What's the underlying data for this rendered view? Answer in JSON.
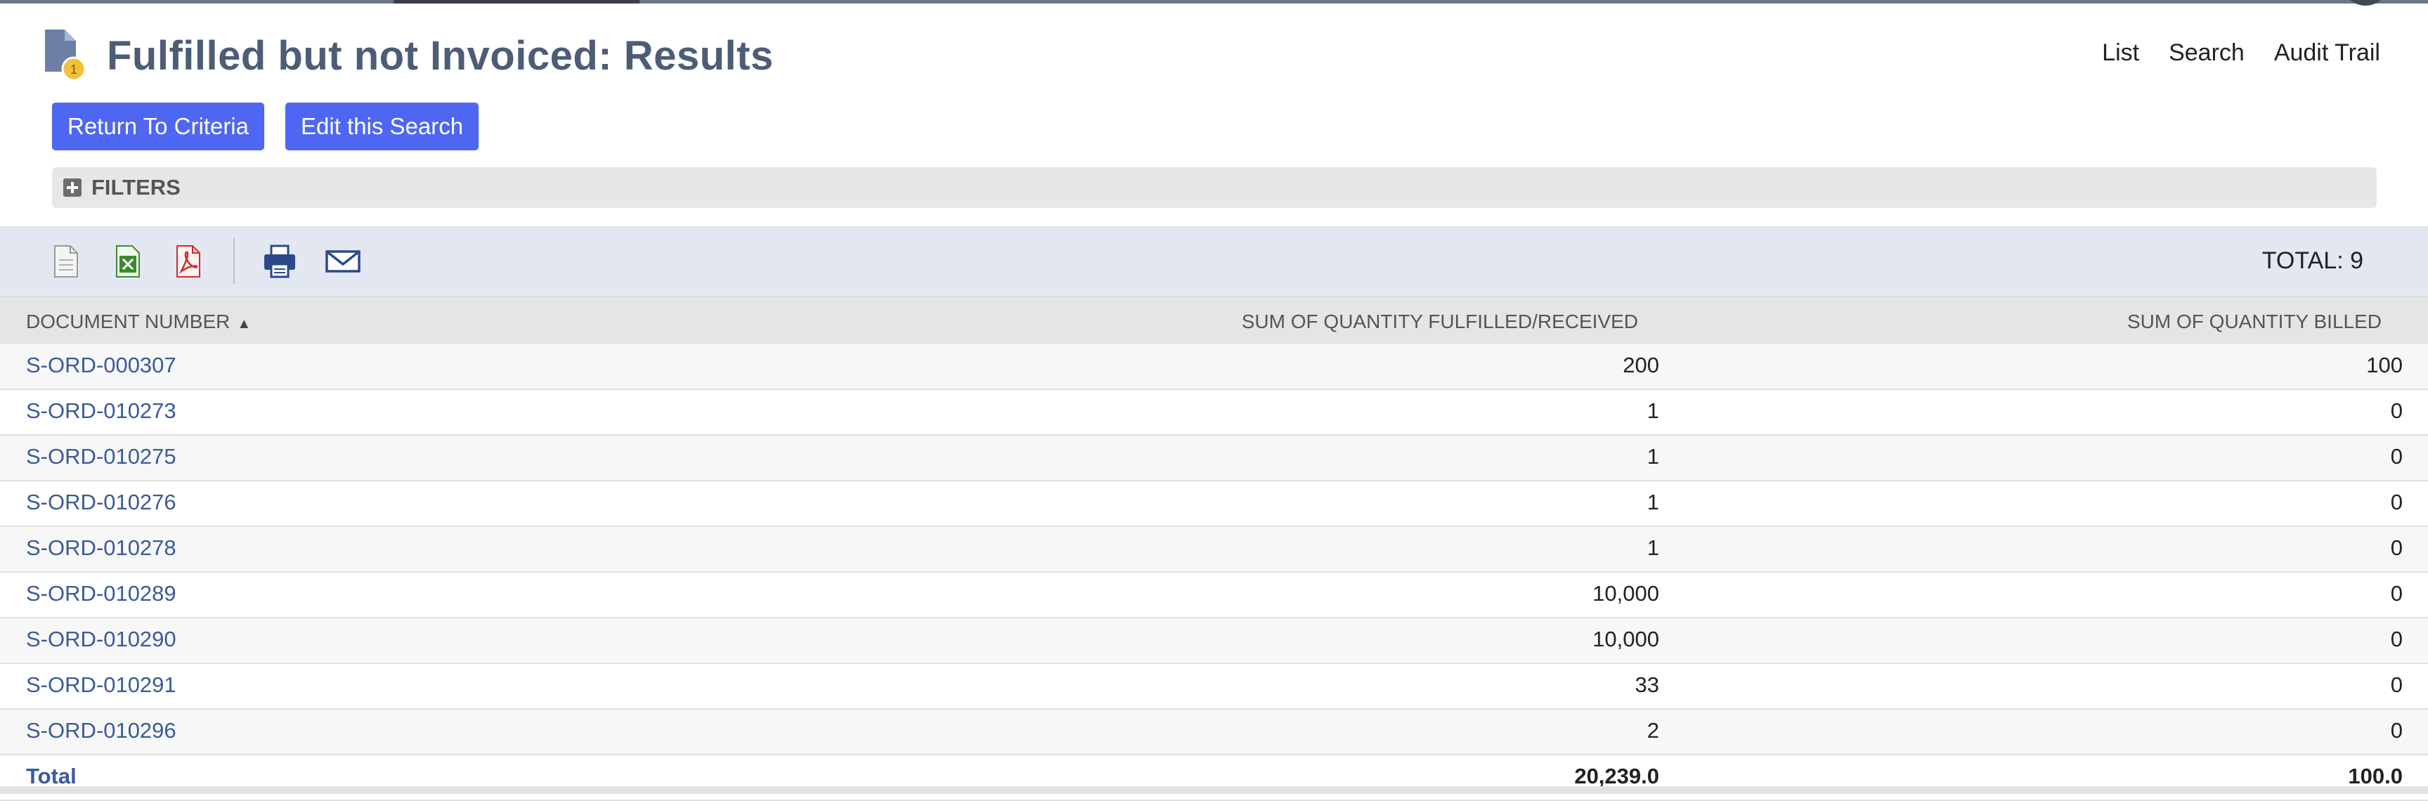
{
  "page": {
    "title": "Fulfilled but not Invoiced: Results"
  },
  "top_links": [
    "List",
    "Search",
    "Audit Trail"
  ],
  "buttons": {
    "return_label": "Return To Criteria",
    "edit_label": "Edit this Search"
  },
  "filters": {
    "label": "FILTERS"
  },
  "toolbar": {
    "icons": [
      "export-csv-icon",
      "export-excel-icon",
      "export-pdf-icon",
      "print-icon",
      "email-icon"
    ],
    "total_label": "TOTAL: 9"
  },
  "table": {
    "columns": [
      "DOCUMENT NUMBER",
      "SUM OF QUANTITY FULFILLED/RECEIVED",
      "SUM OF QUANTITY BILLED"
    ],
    "sort_column": "DOCUMENT NUMBER",
    "sort_direction": "ascending",
    "rows": [
      {
        "doc": "S-ORD-000307",
        "fulfilled": "200",
        "billed": "100"
      },
      {
        "doc": "S-ORD-010273",
        "fulfilled": "1",
        "billed": "0"
      },
      {
        "doc": "S-ORD-010275",
        "fulfilled": "1",
        "billed": "0"
      },
      {
        "doc": "S-ORD-010276",
        "fulfilled": "1",
        "billed": "0"
      },
      {
        "doc": "S-ORD-010278",
        "fulfilled": "1",
        "billed": "0"
      },
      {
        "doc": "S-ORD-010289",
        "fulfilled": "10,000",
        "billed": "0"
      },
      {
        "doc": "S-ORD-010290",
        "fulfilled": "10,000",
        "billed": "0"
      },
      {
        "doc": "S-ORD-010291",
        "fulfilled": "33",
        "billed": "0"
      },
      {
        "doc": "S-ORD-010296",
        "fulfilled": "2",
        "billed": "0"
      }
    ],
    "total": {
      "label": "Total",
      "fulfilled": "20,239.0",
      "billed": "100.0"
    }
  },
  "colors": {
    "title": "#4d5d77",
    "button": "#4f66f2",
    "link": "#3b5a99",
    "toolbar_bg": "#e2e7f1"
  }
}
